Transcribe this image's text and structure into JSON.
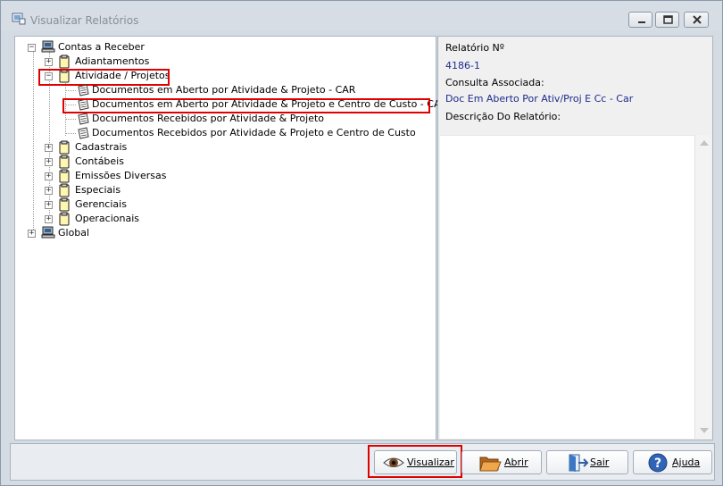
{
  "window": {
    "title": "Visualizar Relatórios"
  },
  "tree": {
    "root1": {
      "label": "Contas a Receber",
      "expander": "−"
    },
    "root1_children": [
      {
        "label": "Adiantamentos",
        "expander": "+"
      },
      {
        "label": "Atividade / Projetos",
        "expander": "−"
      }
    ],
    "reports": [
      "Documentos em Aberto por Atividade & Projeto - CAR",
      "Documentos em Aberto por Atividade & Projeto e Centro de Custo - CAR",
      "Documentos Recebidos por Atividade & Projeto",
      "Documentos Recebidos por Atividade & Projeto e Centro de Custo"
    ],
    "folders": [
      {
        "label": "Cadastrais",
        "expander": "+"
      },
      {
        "label": "Contábeis",
        "expander": "+"
      },
      {
        "label": "Emissões Diversas",
        "expander": "+"
      },
      {
        "label": "Especiais",
        "expander": "+"
      },
      {
        "label": "Gerenciais",
        "expander": "+"
      },
      {
        "label": "Operacionais",
        "expander": "+"
      }
    ],
    "root2": {
      "label": "Global",
      "expander": "+"
    },
    "selected_report_index": 1
  },
  "details": {
    "report_no_label": "Relatório Nº",
    "report_no_value": "4186-1",
    "query_label": "Consulta Associada:",
    "query_value": "Doc Em Aberto Por Ativ/Proj E Cc - Car",
    "description_label": "Descrição Do Relatório:",
    "description_value": ""
  },
  "buttons": {
    "view": "Visualizar",
    "open": "Abrir",
    "exit": "Sair",
    "help": "Ajuda"
  },
  "colors": {
    "highlight": "#e00000",
    "value_text": "#1c2b8c"
  }
}
